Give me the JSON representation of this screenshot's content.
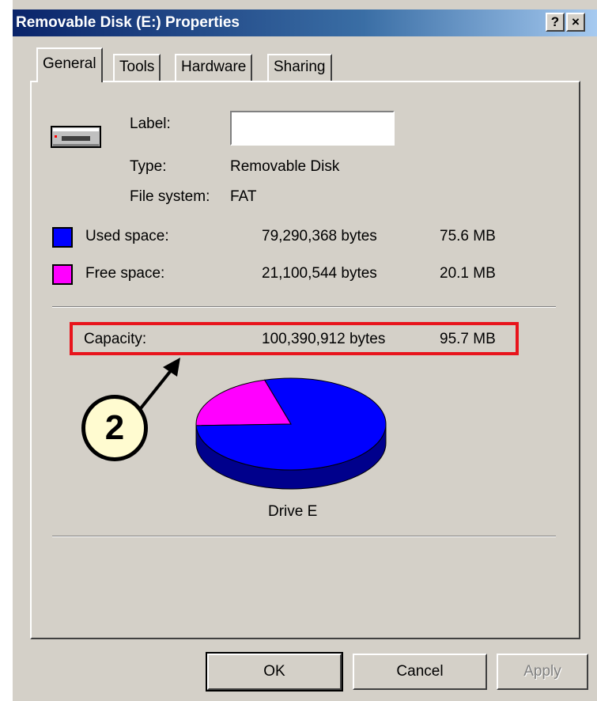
{
  "window": {
    "title": "Removable Disk (E:) Properties",
    "help_button": "?",
    "close_button": "×"
  },
  "tabs": [
    {
      "label": "General",
      "active": true
    },
    {
      "label": "Tools",
      "active": false
    },
    {
      "label": "Hardware",
      "active": false
    },
    {
      "label": "Sharing",
      "active": false
    }
  ],
  "general": {
    "label_caption": "Label:",
    "label_value": "",
    "type_caption": "Type:",
    "type_value": "Removable Disk",
    "filesystem_caption": "File system:",
    "filesystem_value": "FAT",
    "used": {
      "caption": "Used space:",
      "bytes": "79,290,368 bytes",
      "size": "75.6 MB",
      "color": "#0000ff"
    },
    "free": {
      "caption": "Free space:",
      "bytes": "21,100,544 bytes",
      "size": "20.1 MB",
      "color": "#ff00ff"
    },
    "capacity": {
      "caption": "Capacity:",
      "bytes": "100,390,912 bytes",
      "size": "95.7 MB"
    },
    "drive_caption": "Drive E"
  },
  "chart_data": {
    "type": "pie",
    "categories": [
      "Used space",
      "Free space"
    ],
    "values": [
      79290368,
      21100544
    ],
    "colors": [
      "#0000ff",
      "#ff00ff"
    ]
  },
  "buttons": {
    "ok": "OK",
    "cancel": "Cancel",
    "apply": "Apply"
  },
  "annotation": {
    "callout_number": "2",
    "highlight_color": "#e8141c"
  }
}
